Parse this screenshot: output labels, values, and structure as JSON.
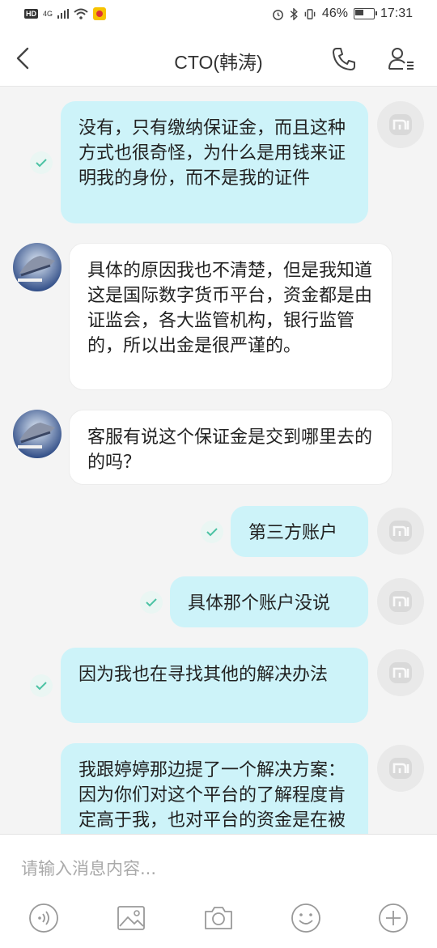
{
  "status_bar": {
    "hd": "HD",
    "signal": "4G",
    "battery": "46%",
    "time": "17:31"
  },
  "header": {
    "title": "CTO(韩涛)"
  },
  "messages": [
    {
      "side": "out",
      "text": "没有，只有缴纳保证金，而且这种方式也很奇怪，为什么是用钱来证明我的身份，而不是我的证件"
    },
    {
      "side": "in",
      "text": "具体的原因我也不清楚，但是我知道这是国际数字货币平台，资金都是由证监会，各大监管机构，银行监管的，所以出金是很严谨的。"
    },
    {
      "side": "in",
      "text": "客服有说这个保证金是交到哪里去的的吗？"
    },
    {
      "side": "out",
      "text": "第三方账户"
    },
    {
      "side": "out",
      "text": "具体那个账户没说"
    },
    {
      "side": "out",
      "text": "因为我也在寻找其他的解决办法"
    },
    {
      "side": "out",
      "text": "我跟婷婷那边提了一个解决方案：因为你们对这个平台的了解程度肯定高于我，也对平台的资金是在被冻结，有没有"
    }
  ],
  "input": {
    "placeholder": "请输入消息内容..."
  },
  "colors": {
    "outgoing_bubble": "#cdf3f9",
    "incoming_bubble": "#ffffff",
    "read_check": "#4cc3a4",
    "background": "#f4f4f4"
  },
  "icons": {
    "back": "chevron-left-icon",
    "call": "phone-icon",
    "contact": "contact-card-icon",
    "voice": "voice-icon",
    "image": "image-icon",
    "camera": "camera-icon",
    "emoji": "emoji-icon",
    "more": "plus-icon"
  }
}
